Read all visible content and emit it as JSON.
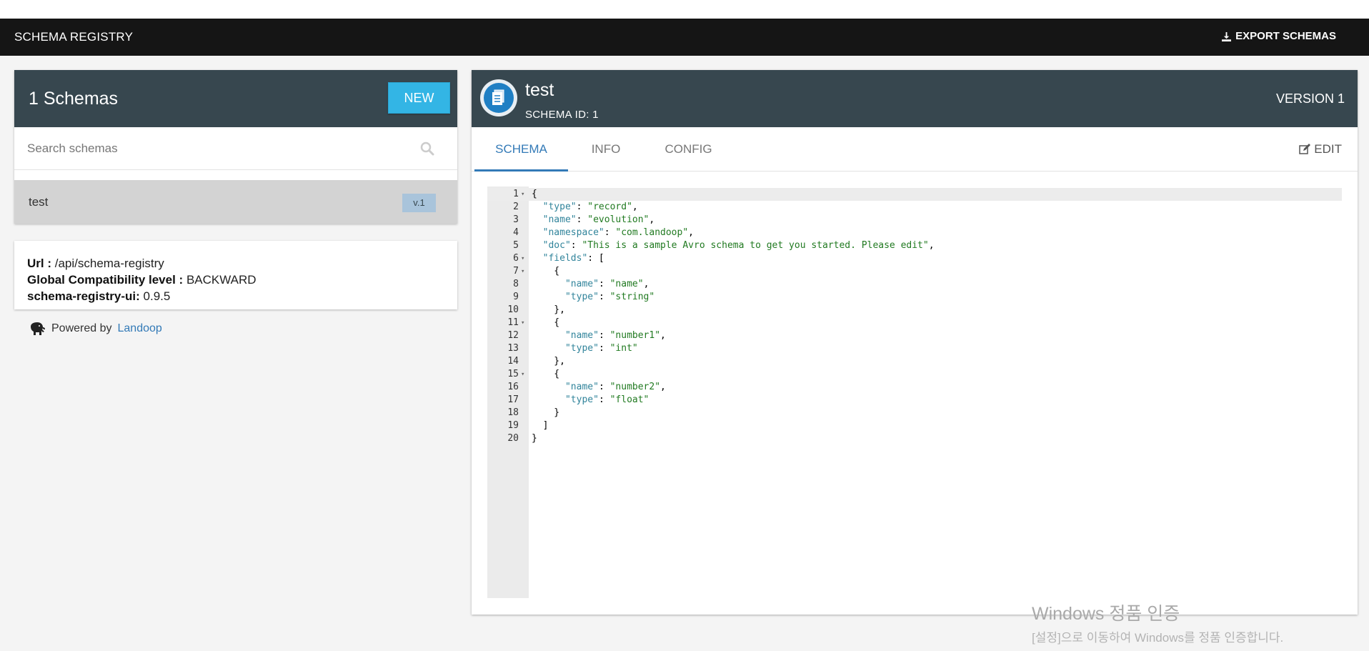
{
  "topbar": {
    "brand": "SCHEMA REGISTRY",
    "export_label": "EXPORT SCHEMAS"
  },
  "schemas": {
    "title": "1 Schemas",
    "new_label": "NEW",
    "search_placeholder": "Search schemas",
    "items": [
      {
        "name": "test",
        "version": "v.1"
      }
    ]
  },
  "info": {
    "url_label": "Url :",
    "url_value": "/api/schema-registry",
    "compat_label": "Global Compatibility level :",
    "compat_value": "BACKWARD",
    "ui_label": "schema-registry-ui:",
    "ui_value": "0.9.5"
  },
  "powered": {
    "prefix": "Powered by",
    "link": "Landoop"
  },
  "detail": {
    "title": "test",
    "schema_id": "SCHEMA ID: 1",
    "version": "VERSION 1",
    "tabs": [
      "SCHEMA",
      "INFO",
      "CONFIG"
    ],
    "active_tab": "SCHEMA",
    "edit_label": "EDIT"
  },
  "code_lines": [
    "{",
    "  \"type\": \"record\",",
    "  \"name\": \"evolution\",",
    "  \"namespace\": \"com.landoop\",",
    "  \"doc\": \"This is a sample Avro schema to get you started. Please edit\",",
    "  \"fields\": [",
    "    {",
    "      \"name\": \"name\",",
    "      \"type\": \"string\"",
    "    },",
    "    {",
    "      \"name\": \"number1\",",
    "      \"type\": \"int\"",
    "    },",
    "    {",
    "      \"name\": \"number2\",",
    "      \"type\": \"float\"",
    "    }",
    "  ]",
    "}"
  ],
  "fold_lines": [
    1,
    6,
    7,
    11,
    15
  ],
  "watermark": {
    "title": "Windows 정품 인증",
    "sub": "[설정]으로 이동하여 Windows를 정품 인증합니다."
  },
  "colors": {
    "header": "#37474f",
    "accent": "#33b5e5",
    "topbar": "#151515",
    "link": "#337ab7"
  }
}
